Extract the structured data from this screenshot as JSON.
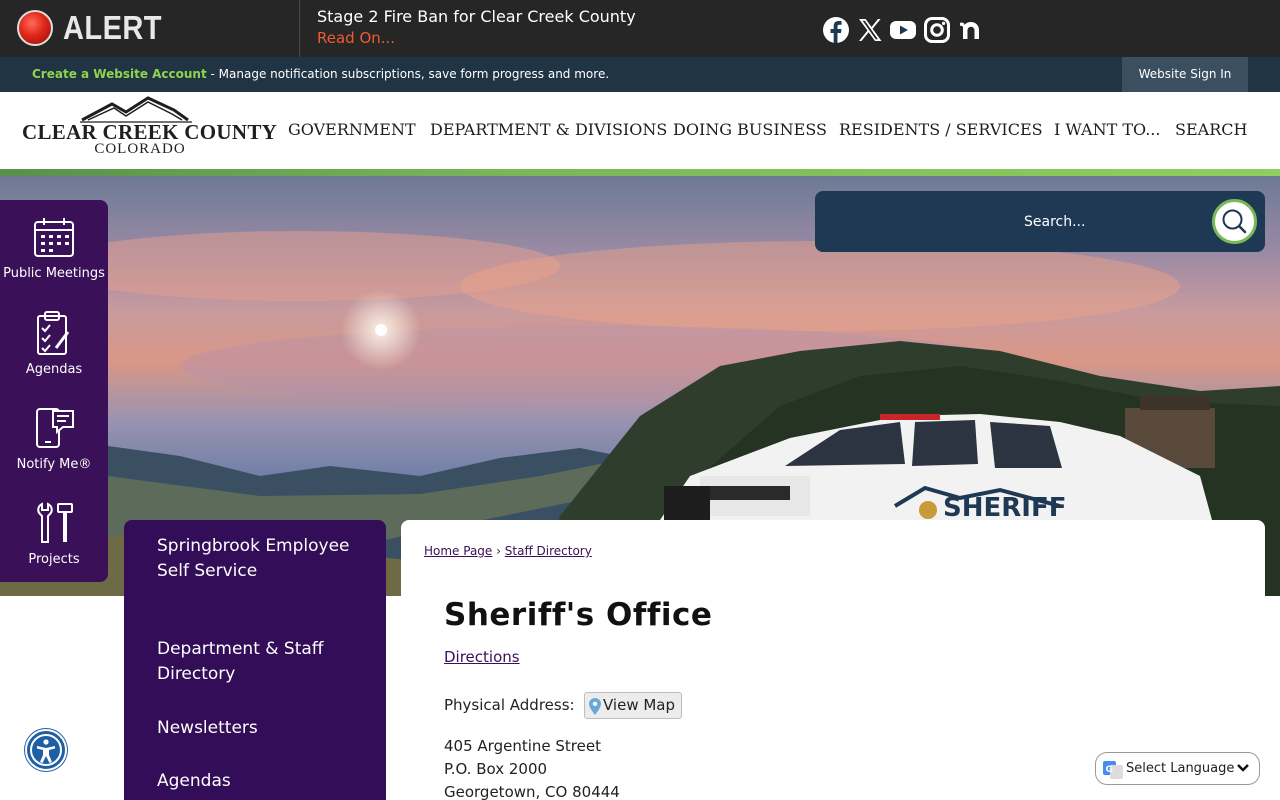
{
  "alert": {
    "label": "ALERT",
    "title": "Stage 2 Fire Ban for Clear Creek County",
    "link": "Read On..."
  },
  "account_bar": {
    "create_link": "Create a Website Account",
    "message": " - Manage notification subscriptions, save form progress and more.",
    "sign_in": "Website Sign In"
  },
  "logo": {
    "name": "CLEAR CREEK COUNTY",
    "sub": "COLORADO"
  },
  "nav": {
    "items": [
      "GOVERNMENT",
      "DEPARTMENT & DIVISIONS",
      "DOING BUSINESS",
      "RESIDENTS / SERVICES",
      "I WANT TO...",
      "SEARCH"
    ]
  },
  "social": {
    "icons": [
      "facebook-icon",
      "x-icon",
      "youtube-icon",
      "instagram-icon",
      "nextdoor-icon"
    ],
    "search_placeholder": "Search..."
  },
  "hero": {
    "truck_text": "SHERIFF"
  },
  "quick_links": [
    {
      "label": "Public Meetings",
      "icon": "calendar-icon"
    },
    {
      "label": "Agendas",
      "icon": "clipboard-icon"
    },
    {
      "label": "Notify Me®",
      "icon": "phone-icon"
    },
    {
      "label": "Projects",
      "icon": "tools-icon"
    }
  ],
  "side_nav": {
    "items": [
      "Springbrook Employee Self Service",
      "Department & Staff Directory",
      "Newsletters",
      "Agendas"
    ]
  },
  "breadcrumb": {
    "home": "Home Page",
    "sep": "›",
    "current": "Staff Directory"
  },
  "page": {
    "title": "Sheriff's Office",
    "directions": "Directions",
    "address_label": "Physical Address:",
    "view_map": "View Map",
    "address_lines": [
      "405 Argentine Street",
      "P.O. Box 2000",
      "Georgetown, CO 80444"
    ]
  },
  "language": {
    "label": "Select Language"
  },
  "colors": {
    "brand_purple": "#3a1159",
    "accent_green": "#79b957",
    "alert_red": "#ef5a34",
    "navy": "#213444"
  }
}
